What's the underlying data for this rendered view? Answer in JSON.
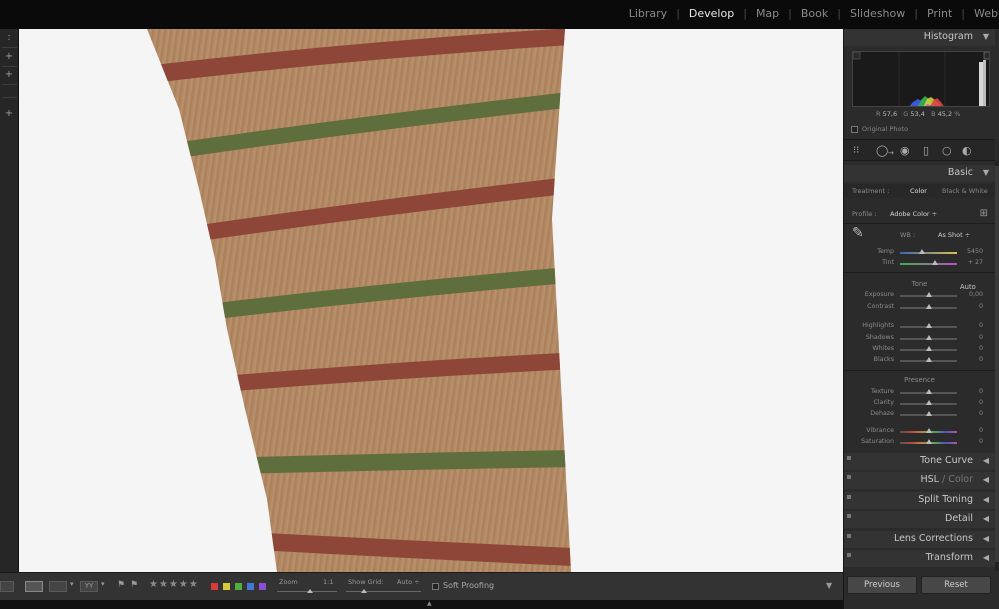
{
  "modules": [
    "Library",
    "Develop",
    "Map",
    "Book",
    "Slideshow",
    "Print",
    "Web"
  ],
  "active_module": "Develop",
  "histogram": {
    "title": "Histogram",
    "r_label": "R",
    "r_value": "57,6",
    "g_label": "G",
    "g_value": "53,4",
    "b_label": "B",
    "b_value": "45,2",
    "percent": "%",
    "original_photo": "Original Photo"
  },
  "basic": {
    "title": "Basic",
    "treatment_label": "Treatment :",
    "treatment_color": "Color",
    "treatment_bw": "Black & White",
    "profile_label": "Profile :",
    "profile_value": "Adobe Color ÷",
    "wb_label": "WB :",
    "wb_value": "As Shot ÷",
    "tone_title": "Tone",
    "auto_label": "Auto",
    "presence_title": "Presence",
    "sliders": {
      "temp": {
        "label": "Temp",
        "value": "5450"
      },
      "tint": {
        "label": "Tint",
        "value": "+ 27"
      },
      "exposure": {
        "label": "Exposure",
        "value": "0,00"
      },
      "contrast": {
        "label": "Contrast",
        "value": "0"
      },
      "highlights": {
        "label": "Highlights",
        "value": "0"
      },
      "shadows": {
        "label": "Shadows",
        "value": "0"
      },
      "whites": {
        "label": "Whites",
        "value": "0"
      },
      "blacks": {
        "label": "Blacks",
        "value": "0"
      },
      "texture": {
        "label": "Texture",
        "value": "0"
      },
      "clarity": {
        "label": "Clarity",
        "value": "0"
      },
      "dehaze": {
        "label": "Dehaze",
        "value": "0"
      },
      "vibrance": {
        "label": "Vibrance",
        "value": "0"
      },
      "saturation": {
        "label": "Saturation",
        "value": "0"
      }
    }
  },
  "panels": {
    "tone_curve": "Tone Curve",
    "hsl": "HSL",
    "hsl_sep": " / ",
    "color": "Color",
    "split_toning": "Split Toning",
    "detail": "Detail",
    "lens_corrections": "Lens Corrections",
    "transform": "Transform"
  },
  "toolbar": {
    "zoom_label": "Zoom",
    "zoom_value": "1:1",
    "show_grid_label": "Show Grid:",
    "show_grid_value": "Auto ÷",
    "soft_proofing": "Soft Proofing",
    "rating_stars": "★★★★★",
    "yy_label": "YY",
    "color_labels": [
      "#d93a3a",
      "#d8c93a",
      "#4fae3f",
      "#3f78d9",
      "#8a4fd3"
    ]
  },
  "buttons": {
    "previous": "Previous",
    "reset": "Reset"
  },
  "icons": {
    "eyedropper": "✎",
    "grid": "⊞",
    "triangle_down": "▼",
    "triangle_left": "◀"
  }
}
